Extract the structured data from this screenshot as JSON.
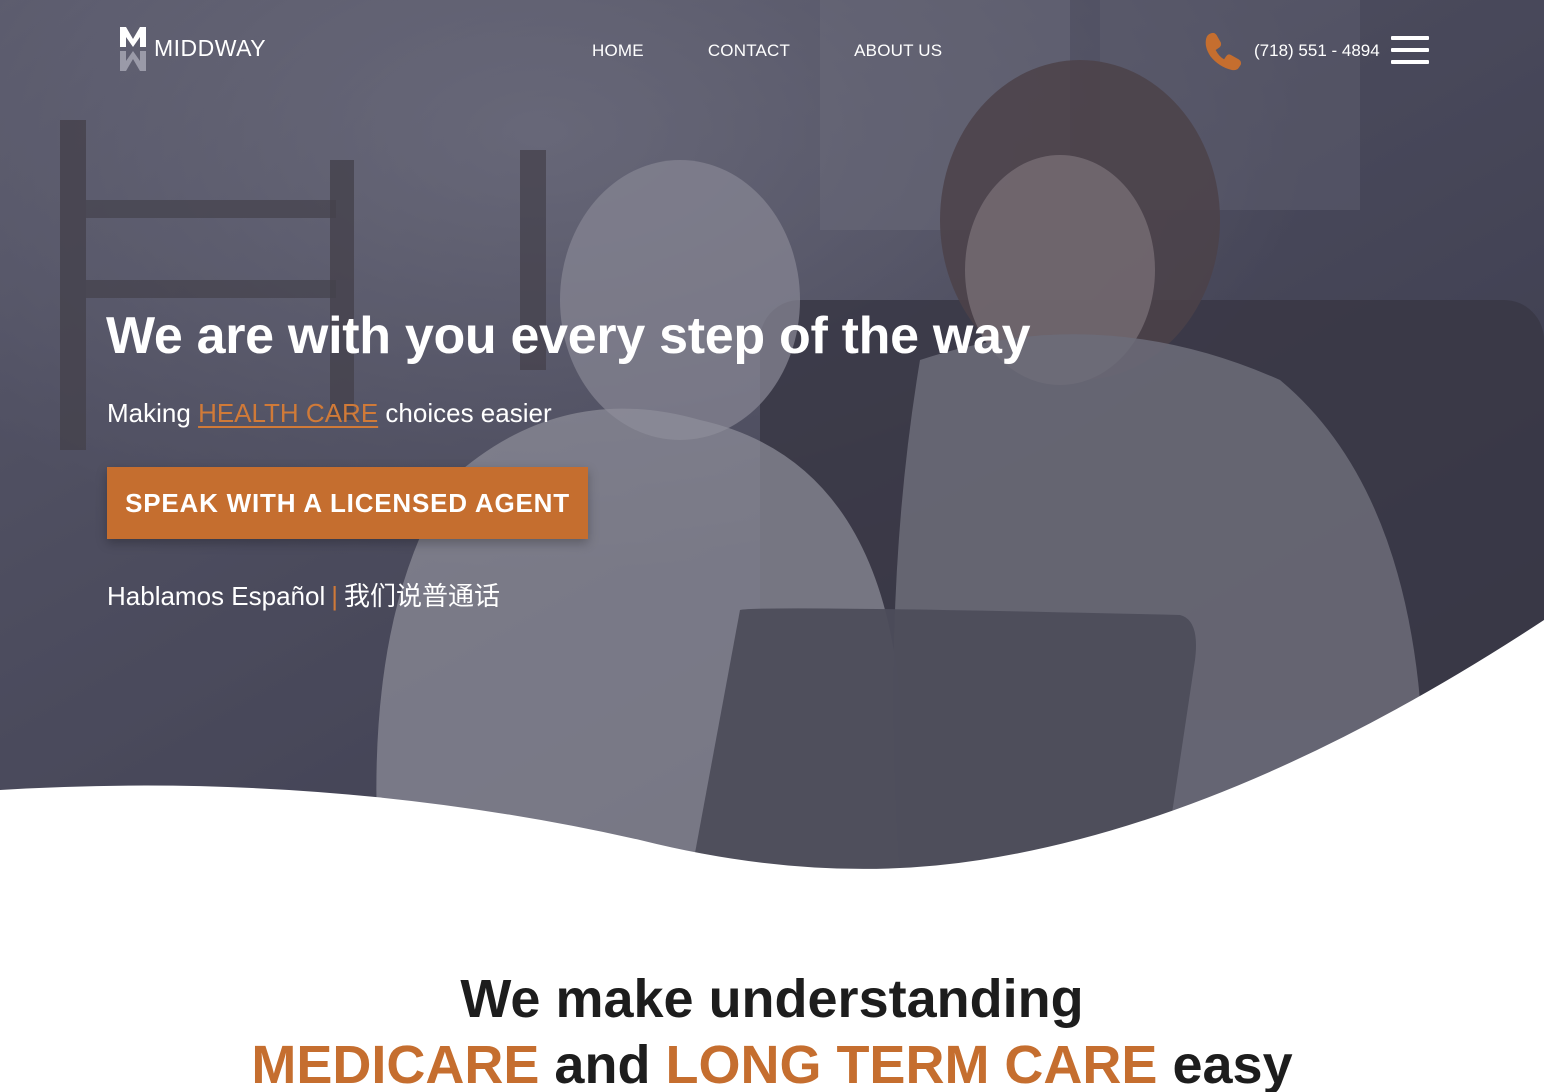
{
  "brand": {
    "name": "MIDDWAY",
    "logo_icon": "middway-m-logo-icon"
  },
  "nav": {
    "items": [
      {
        "label": "HOME"
      },
      {
        "label": "CONTACT"
      },
      {
        "label": "ABOUT US"
      }
    ]
  },
  "contact": {
    "phone": "(718) 551 - 4894",
    "phone_icon": "phone-icon"
  },
  "menu": {
    "icon": "hamburger-menu-icon"
  },
  "hero": {
    "title": "We are with you every step of the way",
    "subtitle_before": "Making",
    "subtitle_link": "HEALTH CARE",
    "subtitle_after": "choices easier",
    "cta_label": "SPEAK WITH A LICENSED AGENT",
    "lang_spanish": "Hablamos Español",
    "lang_separator": "|",
    "lang_chinese": "我们说普通话"
  },
  "section": {
    "line1": "We make understanding",
    "highlight1": "MEDICARE",
    "connector": "and",
    "highlight2": "LONG TERM CARE",
    "ending": "easy"
  },
  "colors": {
    "accent": "#c56e2f",
    "overlay": "#343448",
    "text_dark": "#1d1d1d",
    "background": "#ffffff"
  }
}
